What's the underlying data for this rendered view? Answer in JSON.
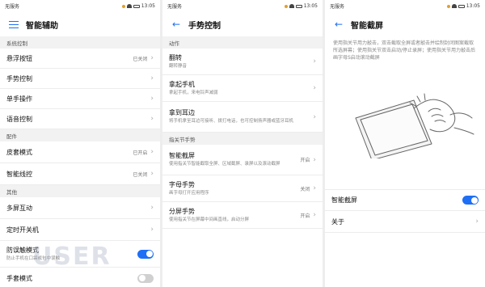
{
  "status_bar": {
    "carrier": "无服务",
    "time": "13:05"
  },
  "panel1": {
    "title": "智能辅助",
    "sections": [
      {
        "header": "系统控制",
        "items": [
          {
            "label": "悬浮按钮",
            "value": "已关闭"
          },
          {
            "label": "手势控制",
            "value": ""
          },
          {
            "label": "单手操作",
            "value": ""
          },
          {
            "label": "语音控制",
            "value": ""
          }
        ]
      },
      {
        "header": "配件",
        "items": [
          {
            "label": "皮套模式",
            "value": "已开启"
          },
          {
            "label": "智能线控",
            "value": "已关闭"
          }
        ]
      },
      {
        "header": "其他",
        "items": [
          {
            "label": "多屏互动",
            "value": ""
          },
          {
            "label": "定时开关机",
            "value": ""
          }
        ]
      }
    ],
    "toggle_rows": [
      {
        "label": "防误触模式",
        "sub": "防止手机在口袋或包中误触",
        "state": "on"
      },
      {
        "label": "手套模式",
        "sub": "",
        "state": "off"
      }
    ]
  },
  "panel2": {
    "title": "手势控制",
    "section1": "动作",
    "actions": [
      {
        "label": "翻转",
        "sub": "翻转静音"
      },
      {
        "label": "拿起手机",
        "sub": "拿起手机，来电铃声减弱"
      },
      {
        "label": "拿到耳边",
        "sub": "将手机拿至耳边可接听、拨打电话，也可控制扬声器或蓝牙耳机"
      }
    ],
    "section2": "指关节手势",
    "knuckle": [
      {
        "label": "智能截屏",
        "sub": "使用指关节智能截取全屏、区域截屏、录屏以及滚动截屏",
        "value": "开启"
      },
      {
        "label": "字母手势",
        "sub": "画字母打开应用程序",
        "value": "关闭"
      },
      {
        "label": "分屏手势",
        "sub": "使用指关节在屏幕中间画直线，启动分屏",
        "value": "开启"
      }
    ]
  },
  "panel3": {
    "title": "智能截屏",
    "description": "使用指关节用力敲击，双击截取全屏或者敲击并绘制封闭图案截取所选屏幕；使用指关节双击启动/停止录屏；使用指关节用力敲击后画字母S启动滚动截屏",
    "toggle_label": "智能截屏",
    "toggle_state": "on",
    "about_label": "关于"
  },
  "watermark": "USER",
  "colors": {
    "accent": "#1e6ff5",
    "section_bg": "#f2f2f2",
    "divider": "#ececec"
  }
}
